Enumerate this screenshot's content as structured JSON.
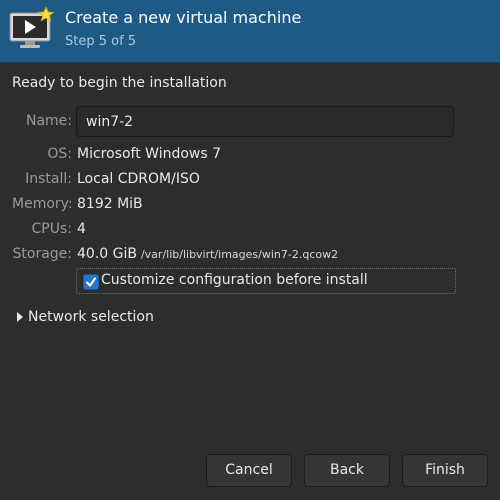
{
  "header": {
    "title": "Create a new virtual machine",
    "subtitle": "Step 5 of 5",
    "icon": "vm-monitor-icon"
  },
  "ready_text": "Ready to begin the installation",
  "details": {
    "name_label": "Name:",
    "name_value": "win7-2",
    "os_label": "OS:",
    "os_value": "Microsoft Windows 7",
    "install_label": "Install:",
    "install_value": "Local CDROM/ISO",
    "memory_label": "Memory:",
    "memory_value": "8192 MiB",
    "cpus_label": "CPUs:",
    "cpus_value": "4",
    "storage_label": "Storage:",
    "storage_value": "40.0 GiB",
    "storage_path": "/var/lib/libvirt/images/win7-2.qcow2"
  },
  "customize": {
    "label": "Customize configuration before install",
    "checked": true
  },
  "network": {
    "label": "Network selection",
    "expanded": false
  },
  "buttons": {
    "cancel": "Cancel",
    "back": "Back",
    "finish": "Finish"
  },
  "colors": {
    "header_bg": "#1f5a85",
    "window_bg": "#2d2d2d",
    "accent": "#2a76c6"
  }
}
